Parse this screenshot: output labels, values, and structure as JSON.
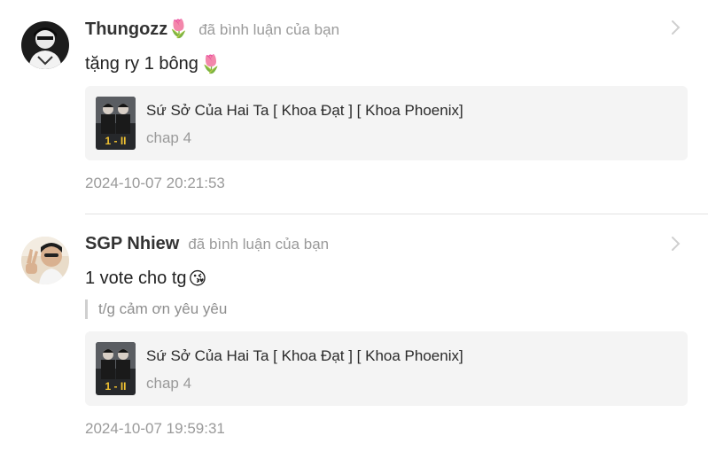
{
  "notifications": [
    {
      "username": "Thungozz",
      "username_emoji": "🌷",
      "action": "đã bình luận của bạn",
      "comment": "tặng ry 1 bông",
      "comment_emoji": "🌷",
      "quote": "",
      "story_title": "Sứ Sở Của Hai Ta [ Khoa Đạt ] [ Khoa Phoenix]",
      "story_chapter": "chap 4",
      "timestamp": "2024-10-07 20:21:53"
    },
    {
      "username": "SGP Nhiew",
      "username_emoji": "",
      "action": "đã bình luận của bạn",
      "comment": "1 vote cho tg",
      "comment_emoji": "😘",
      "quote": "t/g cảm ơn yêu yêu",
      "story_title": "Sứ Sở Của Hai Ta [ Khoa Đạt ] [ Khoa Phoenix]",
      "story_chapter": "chap 4",
      "timestamp": "2024-10-07 19:59:31"
    }
  ],
  "icons": {
    "chevron": "chevron-right-icon",
    "tulip": "tulip-emoji",
    "kiss": "face-blowing-kiss-emoji"
  },
  "colors": {
    "card_background": "#f4f4f4",
    "muted_text": "#9a9a9a",
    "divider": "#e2e2e2"
  }
}
